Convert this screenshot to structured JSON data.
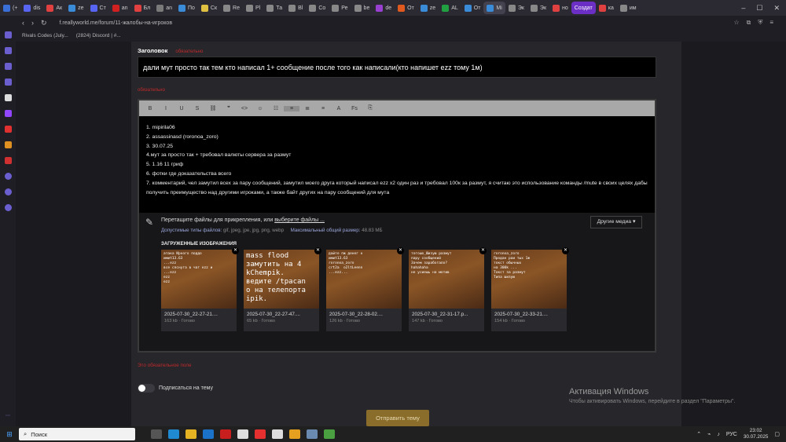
{
  "tabs": [
    {
      "label": "(+",
      "color": "#3a6fd8"
    },
    {
      "label": "dis",
      "color": "#5865f2"
    },
    {
      "label": "Ак",
      "color": "#e04040"
    },
    {
      "label": "ze",
      "color": "#3a8bd8"
    },
    {
      "label": "Ст",
      "color": "#5865f2"
    },
    {
      "label": "an",
      "color": "#d02020"
    },
    {
      "label": "Бл",
      "color": "#e04040"
    },
    {
      "label": "an",
      "color": "#7a7a7a"
    },
    {
      "label": "По",
      "color": "#3a8bd8"
    },
    {
      "label": "Ск",
      "color": "#e0c040"
    },
    {
      "label": "Re",
      "color": "#888"
    },
    {
      "label": "Pl",
      "color": "#888"
    },
    {
      "label": "Та",
      "color": "#888"
    },
    {
      "label": "Bl",
      "color": "#888"
    },
    {
      "label": "Co",
      "color": "#888"
    },
    {
      "label": "Ре",
      "color": "#888"
    },
    {
      "label": "be",
      "color": "#888"
    },
    {
      "label": "de",
      "color": "#9a40d0"
    },
    {
      "label": "От",
      "color": "#e05a20"
    },
    {
      "label": "ze",
      "color": "#3a8bd8"
    },
    {
      "label": "AL",
      "color": "#20a040"
    },
    {
      "label": "От",
      "color": "#3a8bd8"
    },
    {
      "label": "Mi",
      "color": "#3a8bd8",
      "active": true
    },
    {
      "label": "Эк",
      "color": "#888"
    },
    {
      "label": "Эк",
      "color": "#888"
    },
    {
      "label": "но",
      "color": "#e04040"
    },
    {
      "label": "Создат",
      "color": "#6b2fc5",
      "create": true
    },
    {
      "label": "ка",
      "color": "#e04040"
    },
    {
      "label": "им",
      "color": "#888"
    }
  ],
  "url": "f.reallyworld.me/forum/11-жалобы-на-игроков",
  "bookmarks": [
    "Rivals Codes (July...",
    "(2824) Discord | #..."
  ],
  "form": {
    "title_label": "Заголовок",
    "title_required": "обязательно",
    "title_value": "дали мут просто так тем кто написал 1+ сообщение после того как написали(кто напишет ezz тому 1м)",
    "body_required": "обязательно",
    "body_lines": [
      "1. mipirila06",
      "2. assassinasd (roronoa_zoro)",
      "3. 30.07.25",
      "4.мут за просто так + требовал валюты сервера за размут",
      "5. 1.16 11 гриф",
      "6. фотки где доказательства всего",
      "7. комментарий, чел замутил всех за пару сообщений, замутил моего друга который написал ezz x2 один раз и требовал 100к за размут, я считаю это использование команды /mute в своих целях дабы получить преимущество над другими игроками, а также байт других на пару сообщений для мута"
    ],
    "drop_text": "Перетащите файлы для прикрепления, или ",
    "drop_link": "выберите файлы ...",
    "allowed_label": "Допустимые типы файлов:",
    "allowed_value": "gif, jpeg, jpe, jpg, png, webp",
    "max_label": "Максимальный общий размер:",
    "max_value": "48.83 МБ",
    "other_media": "Другие медиа ▾",
    "uploaded_label": "ЗАГРУЖЕННЫЕ ИЗОБРАЖЕНИЯ",
    "error_text": "Это обязательное поле",
    "subscribe_label": "Подписаться на тему",
    "submit_label": "Отправить тему"
  },
  "images": [
    {
      "name": "2025-07-30_22-27-21....",
      "meta": "163 kb · Готово",
      "preview": "атака Ирного поддо\nимиt13.63\n...ezz\nвсе сяснута в чат ezz и\n...ezz\nezz\nezz"
    },
    {
      "name": "2025-07-30_22-27-47....",
      "meta": "65 kb · Готово",
      "preview": "mass flood\nзамутить на 4\nkChempik.\nведите /tpacan\nо на телепорта\nipik.",
      "big": true
    },
    {
      "name": "2025-07-30_22-28-02....",
      "meta": "126 kb · Готово",
      "preview": "дайте пж денег н\nимиt13.63\nroronoa_zoro\ncrt2a  o2ltLeenn\n...ezz..."
    },
    {
      "name": "2025-07-30_22-31-17.p...",
      "meta": "147 kb · Готово",
      "preview": "тогошо_Шизую размут\nпару сообщений\nЗачем заработало?\nhahahaha\nне усиешь на мотив"
    },
    {
      "name": "2025-07-30_22-33-21....",
      "meta": "154 kb · Готово",
      "preview": "roronoa_zoro\nПродан раи тых 1ж\nтокст обычных\nна 300k ...\nТокст за размут\nТипа шизую"
    }
  ],
  "toolbar": [
    "B",
    "I",
    "U",
    "S",
    "⛓",
    "❞",
    "<>",
    "☺",
    "☷",
    "≡",
    "≣",
    "≡",
    "A",
    "Fs",
    "⎘"
  ],
  "activation": {
    "title": "Активация Windows",
    "subtitle": "Чтобы активировать Windows, перейдите в раздел \"Параметры\"."
  },
  "taskbar": {
    "search": "Поиск",
    "lang": "РУС",
    "time": "23:02",
    "date": "30.07.2025"
  }
}
